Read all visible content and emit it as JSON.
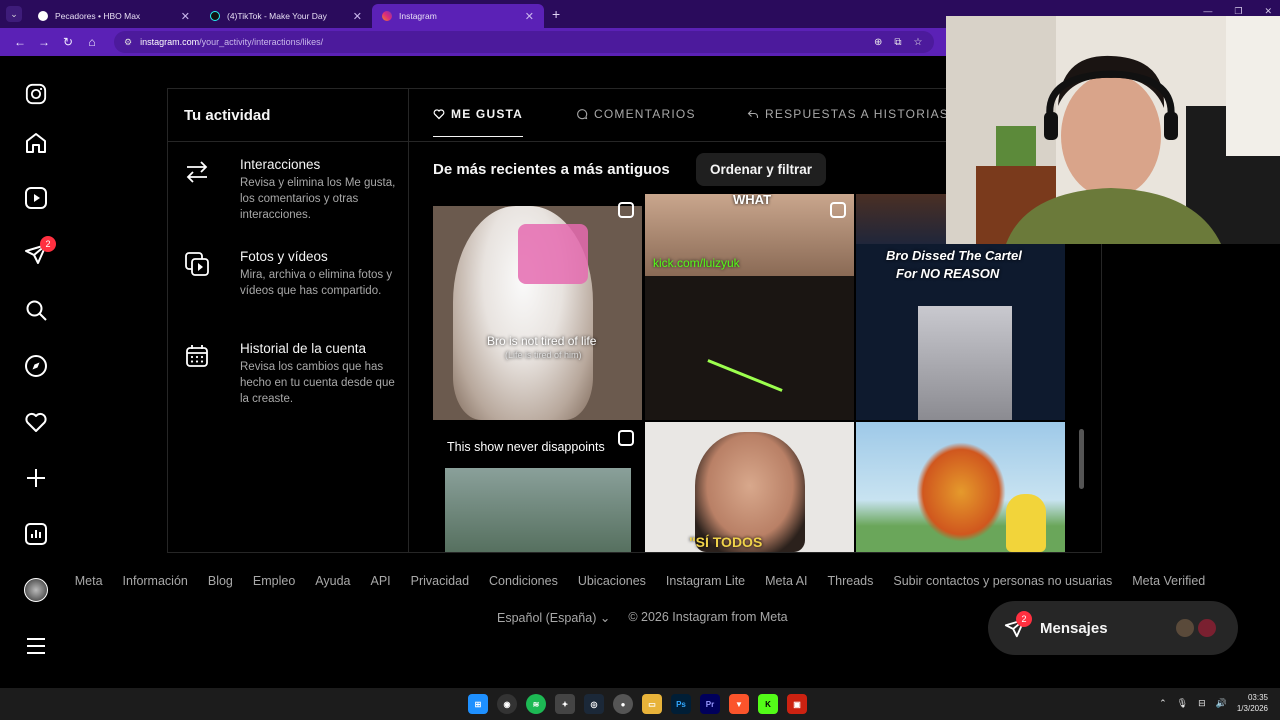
{
  "browser": {
    "tabs": [
      {
        "title": "Pecadores • HBO Max",
        "fav_color": "#ffffff",
        "active": false
      },
      {
        "title": "(4)TikTok - Make Your Day",
        "fav_color": "#000000",
        "active": false
      },
      {
        "title": "Instagram",
        "fav_color": "#e1306c",
        "active": true
      }
    ],
    "new_tab": "+",
    "url_host": "instagram.com",
    "url_path": "/your_activity/interactions/likes/"
  },
  "rail": {
    "notifications_badge": "2"
  },
  "activity": {
    "title": "Tu actividad",
    "items": [
      {
        "title": "Interacciones",
        "desc": "Revisa y elimina los Me gusta, los comentarios y otras interacciones."
      },
      {
        "title": "Fotos y vídeos",
        "desc": "Mira, archiva o elimina fotos y vídeos que has compartido."
      },
      {
        "title": "Historial de la cuenta",
        "desc": "Revisa los cambios que has hecho en tu cuenta desde que la creaste."
      }
    ]
  },
  "tabs": {
    "likes": "ME GUSTA",
    "comments": "COMENTARIOS",
    "story_replies": "RESPUESTAS A HISTORIAS"
  },
  "sort_label": "De más recientes a más antiguos",
  "filter_button": "Ordenar y filtrar",
  "grid": {
    "captions": {
      "cat": "Bro is not tired of life",
      "cat_sub": "(Life is tired of him)",
      "what": "WHAT",
      "kick": "kick.com/luizyuk",
      "cartel": "Bro Dissed The Cartel",
      "cartel_sub": "For NO REASON",
      "show": "This show never disappoints",
      "todos": "\"SÍ TODOS"
    }
  },
  "footer": {
    "links": [
      "Meta",
      "Información",
      "Blog",
      "Empleo",
      "Ayuda",
      "API",
      "Privacidad",
      "Condiciones",
      "Ubicaciones",
      "Instagram Lite",
      "Meta AI",
      "Threads",
      "Subir contactos y personas no usuarias",
      "Meta Verified"
    ],
    "language": "Español (España)",
    "copyright": "© 2026 Instagram from Meta"
  },
  "messages": {
    "label": "Mensajes",
    "badge": "2"
  },
  "taskbar": {
    "time": "03:35",
    "date": "1/3/2026"
  }
}
